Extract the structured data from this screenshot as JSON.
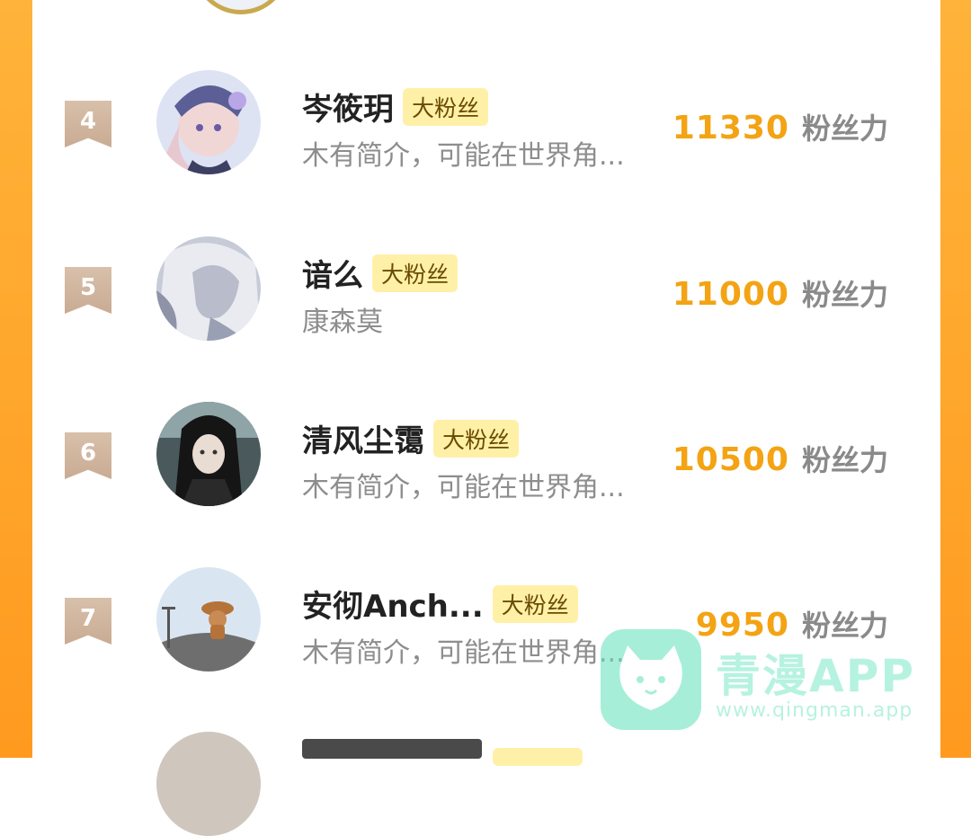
{
  "entries": [
    {
      "rank": "4",
      "name": "岑筱玥",
      "badge": "大粉丝",
      "bio": "木有简介，可能在世界角...",
      "score": "11330",
      "unit": "粉丝力"
    },
    {
      "rank": "5",
      "name": "谙么",
      "badge": "大粉丝",
      "bio": "康森莫",
      "score": "11000",
      "unit": "粉丝力"
    },
    {
      "rank": "6",
      "name": "清风尘霭",
      "badge": "大粉丝",
      "bio": "木有简介，可能在世界角...",
      "score": "10500",
      "unit": "粉丝力"
    },
    {
      "rank": "7",
      "name": "安彻Anch...",
      "badge": "大粉丝",
      "bio": "木有简介，可能在世界角...",
      "score": "9950",
      "unit": "粉丝力"
    }
  ],
  "watermark": {
    "title": "青漫APP",
    "url": "www.qingman.app"
  },
  "colors": {
    "frame": "#ff9f24",
    "score": "#f3a313",
    "badge_bg": "#fff0a8",
    "rank_badge": "#d4b9a2"
  }
}
